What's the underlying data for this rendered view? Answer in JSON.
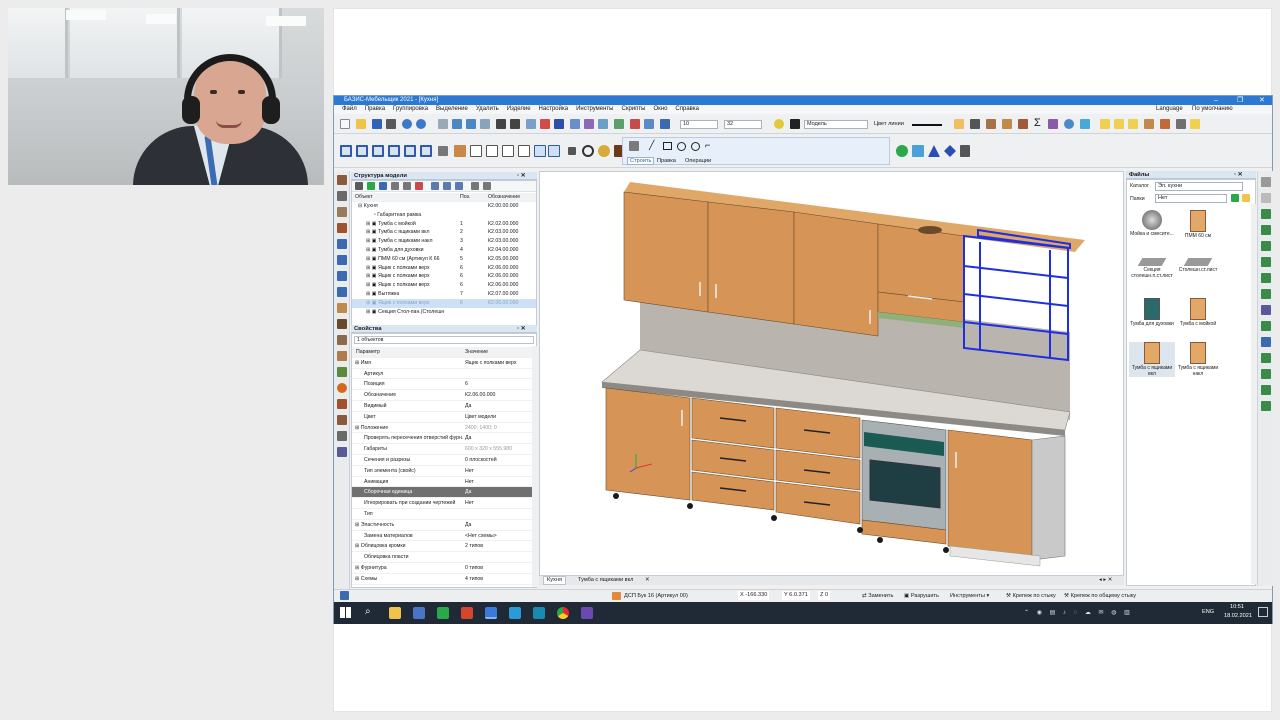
{
  "app": {
    "title": "БАЗИС-Мебельщик 2021 - [Кухня]",
    "menu": [
      "Файл",
      "Правка",
      "Группировка",
      "Выделение",
      "Удалить",
      "Изделие",
      "Настройка",
      "Инструменты",
      "Скрипты",
      "Окно",
      "Справка"
    ],
    "language_label": "Language",
    "default_label": "По умолчанию",
    "toolbar": {
      "line_width": "10",
      "line_step": "32",
      "model_select": "Модель",
      "color_label": "Цвет линии"
    },
    "command_tabs": [
      "Строить",
      "Правка",
      "Операции"
    ]
  },
  "tree": {
    "title": "Структура модели",
    "headers": {
      "name": "Объект",
      "pos": "Поз.",
      "code": "Обозначение"
    },
    "rows": [
      {
        "name": "Кухня",
        "pos": "",
        "code": "К2.00.00.000",
        "indent": 0
      },
      {
        "name": "Габаритная рамка",
        "pos": "",
        "code": "",
        "indent": 1
      },
      {
        "name": "Тумба с мойкой",
        "pos": "1",
        "code": "К2.02.00.000",
        "indent": 1
      },
      {
        "name": "Тумба с ящиками вкл",
        "pos": "2",
        "code": "К2.03.00.000",
        "indent": 1
      },
      {
        "name": "Тумба с ящиками накл",
        "pos": "3",
        "code": "К2.03.00.000",
        "indent": 1
      },
      {
        "name": "Тумба для духовки",
        "pos": "4",
        "code": "К2.04.00.000",
        "indent": 1
      },
      {
        "name": "ПММ 60 см (Артикул К 66",
        "pos": "5",
        "code": "К2.05.00.000",
        "indent": 1
      },
      {
        "name": "Ящик с полками верх",
        "pos": "6",
        "code": "К2.06.00.000",
        "indent": 1
      },
      {
        "name": "Ящик с полками верх",
        "pos": "6",
        "code": "К2.06.00.000",
        "indent": 1
      },
      {
        "name": "Ящик с полками верх",
        "pos": "6",
        "code": "К2.06.00.000",
        "indent": 1
      },
      {
        "name": "Вытяжка",
        "pos": "7",
        "code": "К2.07.00.000",
        "indent": 1
      },
      {
        "name": "Ящик с полками верх",
        "pos": "6",
        "code": "К2.06.00.000",
        "indent": 1
      },
      {
        "name": "Секция Стол-пан.(Столешн",
        "pos": "",
        "code": "",
        "indent": 1
      }
    ]
  },
  "props": {
    "title": "Свойства",
    "selector": "1 объектов",
    "headers": {
      "param": "Параметр",
      "value": "Значение"
    },
    "rows": [
      {
        "name": "Имя",
        "value": "Ящик с полками верх",
        "group": true
      },
      {
        "name": "Артикул",
        "value": ""
      },
      {
        "name": "Позиция",
        "value": "6"
      },
      {
        "name": "Обозначение",
        "value": "К2.06.00.000"
      },
      {
        "name": "Видимый",
        "value": "Да"
      },
      {
        "name": "Цвет",
        "value": "Цвет модели"
      },
      {
        "name": "Положение",
        "value": "2400; 1400; 0",
        "group": true
      },
      {
        "name": "Проверять пересечения отверстий фурн.",
        "value": "Да"
      },
      {
        "name": "Габариты",
        "value": "600 x 320 x 555.980"
      },
      {
        "name": "Сечения и разрезы",
        "value": "0 плоскостей"
      },
      {
        "name": "Тип элемента (свойс)",
        "value": "Нет"
      },
      {
        "name": "Анимация",
        "value": "Нет"
      },
      {
        "name": "Сборочная единица",
        "value": "Да",
        "selected": true
      },
      {
        "name": "Игнорировать при создании чертежей",
        "value": "Нет"
      },
      {
        "name": "Тип",
        "value": ""
      },
      {
        "name": "Эластичность",
        "value": "Да",
        "group": true
      },
      {
        "name": "Замена материалов",
        "value": "<Нет схемы>"
      },
      {
        "name": "Облицовка кромки",
        "value": "2 типов",
        "group": true
      },
      {
        "name": "Облицовка пласти",
        "value": ""
      },
      {
        "name": "Фурнитура",
        "value": "0 типов",
        "group": true
      },
      {
        "name": "Схемы",
        "value": "4 типов",
        "group": true
      }
    ]
  },
  "files": {
    "title": "Файлы",
    "folder_label": "Каталог",
    "folder_value": "Эл. кухни",
    "filter_label": "Папки",
    "filter_value": "Нет",
    "items": [
      {
        "label": "Мойка и смесите...",
        "icon": "sink-icon"
      },
      {
        "label": "ПММ 60 см",
        "icon": "cabinet-icon"
      },
      {
        "label": "Секция столешн.п.ст.лист",
        "icon": "worktop-icon"
      },
      {
        "label": "Столешн.ст.лист",
        "icon": "worktop-icon"
      },
      {
        "label": "Тумба для духовки",
        "icon": "oven-cabinet-icon"
      },
      {
        "label": "Тумба с мойкой",
        "icon": "cabinet-icon"
      },
      {
        "label": "Тумба с ящиками вкл",
        "icon": "drawer-cabinet-icon"
      },
      {
        "label": "Тумба с ящиками накл",
        "icon": "drawer-cabinet-icon"
      }
    ]
  },
  "viewport": {
    "tabs": [
      "Кухня",
      "Тумба с ящиками вкл"
    ]
  },
  "status": {
    "object": "ДСП Бук 16 (Артикул 00)",
    "x": "X -166.330",
    "y": "Y 6.0.371",
    "z": "Z 0",
    "buttons": [
      "Заменить",
      "Разрушить",
      "Инструменты",
      "Крепеж по стыку",
      "Крепеж по общему стыку"
    ]
  },
  "taskbar": {
    "time": "10:51",
    "date": "18.02.2021",
    "lang": "ENG"
  }
}
